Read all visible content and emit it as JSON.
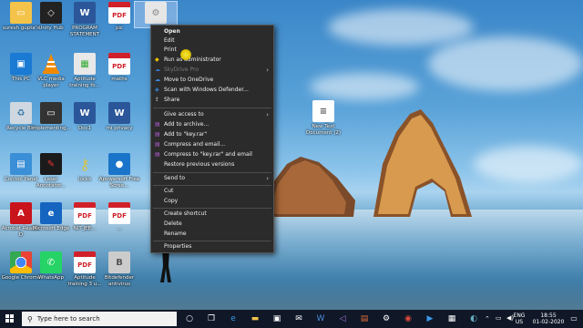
{
  "desktop": {
    "icons": [
      {
        "label": "suresh gupta's",
        "icon": "folder-icon"
      },
      {
        "label": "Unity Hub",
        "icon": "unity-icon"
      },
      {
        "label": "PROGRAM STATEMENT",
        "icon": "word-icon"
      },
      {
        "label": "pic",
        "icon": "pdf-icon"
      },
      {
        "label": "This PC",
        "icon": "this-pc-icon"
      },
      {
        "label": "VLC media player",
        "icon": "vlc-icon"
      },
      {
        "label": "Aptitude training fo...",
        "icon": "apk-icon"
      },
      {
        "label": "maths",
        "icon": "pdf-icon"
      },
      {
        "label": "Recycle Bin",
        "icon": "recycle-bin-icon"
      },
      {
        "label": "Implementing...",
        "icon": "tablet-icon"
      },
      {
        "label": "Doc1",
        "icon": "word-icon"
      },
      {
        "label": "mi privacy",
        "icon": "word-icon"
      },
      {
        "label": "Control Panel",
        "icon": "control-panel-icon"
      },
      {
        "label": "Laser Annotator...",
        "icon": "laser-icon"
      },
      {
        "label": "locks",
        "icon": "keys-icon"
      },
      {
        "label": "Apowersoft Free Scree...",
        "icon": "recorder-icon"
      },
      {
        "label": "Acrobat Reader D",
        "icon": "acrobat-icon"
      },
      {
        "label": "Microsoft Edge",
        "icon": "edge-icon"
      },
      {
        "label": "NIT JEE...",
        "icon": "pdf-icon"
      },
      {
        "label": "...",
        "icon": "pdf-icon"
      },
      {
        "label": "Google Chrome",
        "icon": "chrome-icon"
      },
      {
        "label": "WhatsApp",
        "icon": "whatsapp-icon"
      },
      {
        "label": "Aptitude training 3 u...",
        "icon": "pdf-icon"
      },
      {
        "label": "Bitdefender antivirus",
        "icon": "bitdefender-icon"
      },
      {
        "label": "New Text Document (2)",
        "icon": "text-document-icon"
      }
    ]
  },
  "context_menu": {
    "items": [
      {
        "label": "Open",
        "bold": true
      },
      {
        "label": "Edit"
      },
      {
        "label": "Print"
      },
      {
        "label": "Run as administrator",
        "icon": "shield-icon"
      },
      {
        "label": "SkyDrive Pro",
        "dim": true,
        "submenu": true
      },
      {
        "label": "Move to OneDrive",
        "icon": "onedrive-icon"
      },
      {
        "label": "Scan with Windows Defender...",
        "icon": "defender-icon"
      },
      {
        "label": "Share",
        "icon": "share-icon"
      },
      {
        "label": "Give access to",
        "submenu": true
      },
      {
        "label": "Add to archive...",
        "icon": "winrar-icon"
      },
      {
        "label": "Add to \"key.rar\"",
        "icon": "winrar-icon"
      },
      {
        "label": "Compress and email...",
        "icon": "winrar-icon"
      },
      {
        "label": "Compress to \"key.rar\" and email",
        "icon": "winrar-icon"
      },
      {
        "label": "Restore previous versions"
      },
      {
        "label": "Send to",
        "submenu": true
      },
      {
        "label": "Cut"
      },
      {
        "label": "Copy"
      },
      {
        "label": "Create shortcut"
      },
      {
        "label": "Delete"
      },
      {
        "label": "Rename"
      },
      {
        "label": "Properties"
      }
    ]
  },
  "taskbar": {
    "search_placeholder": "Type here to search",
    "language": "ENG",
    "region": "US",
    "time": "18:55",
    "date": "01-02-2020"
  },
  "colors": {
    "menu_bg": "#2b2b2b",
    "taskbar_bg": "#101828",
    "accent": "#1a7ad4"
  }
}
